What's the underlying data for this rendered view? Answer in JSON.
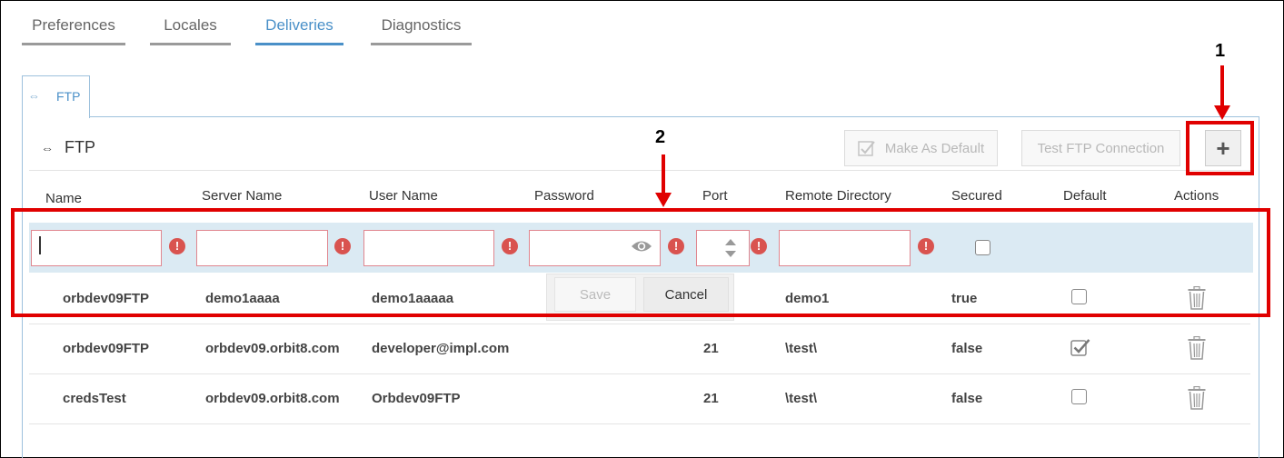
{
  "tabs": [
    "Preferences",
    "Locales",
    "Deliveries",
    "Diagnostics"
  ],
  "active_tab": "Deliveries",
  "sub_tab": {
    "icon": "ftp-icon",
    "label": "FTP"
  },
  "panel": {
    "title": "FTP",
    "title_icon": "ftp-arrows-icon",
    "buttons": {
      "make_default": "Make As Default",
      "test_connection": "Test FTP Connection",
      "add": "+"
    }
  },
  "columns": [
    "Name",
    "Server Name",
    "User Name",
    "Password",
    "Port",
    "Remote Directory",
    "Secured",
    "Default",
    "Actions"
  ],
  "edit_row": {
    "name": "",
    "server_name": "",
    "user_name": "",
    "password": "",
    "port": "",
    "remote_directory": "",
    "secured": false,
    "error_glyph": "!"
  },
  "edit_actions": {
    "save": "Save",
    "cancel": "Cancel"
  },
  "rows": [
    {
      "name": "orbdev09FTP",
      "server_name": "demo1aaaa",
      "user_name": "demo1aaaaa",
      "port": "",
      "remote_directory": "demo1",
      "secured": "true",
      "default": false
    },
    {
      "name": "orbdev09FTP",
      "server_name": "orbdev09.orbit8.com",
      "user_name": "developer@impl.com",
      "port": "21",
      "remote_directory": "\\test\\",
      "secured": "false",
      "default": true
    },
    {
      "name": "credsTest",
      "server_name": "orbdev09.orbit8.com",
      "user_name": "Orbdev09FTP",
      "port": "21",
      "remote_directory": "\\test\\",
      "secured": "false",
      "default": false
    }
  ],
  "annotations": [
    "1",
    "2"
  ],
  "colors": {
    "accent": "#4a90c8",
    "error": "#d9534f",
    "highlight": "#e00000",
    "edit_row_bg": "#dbeaf3"
  }
}
